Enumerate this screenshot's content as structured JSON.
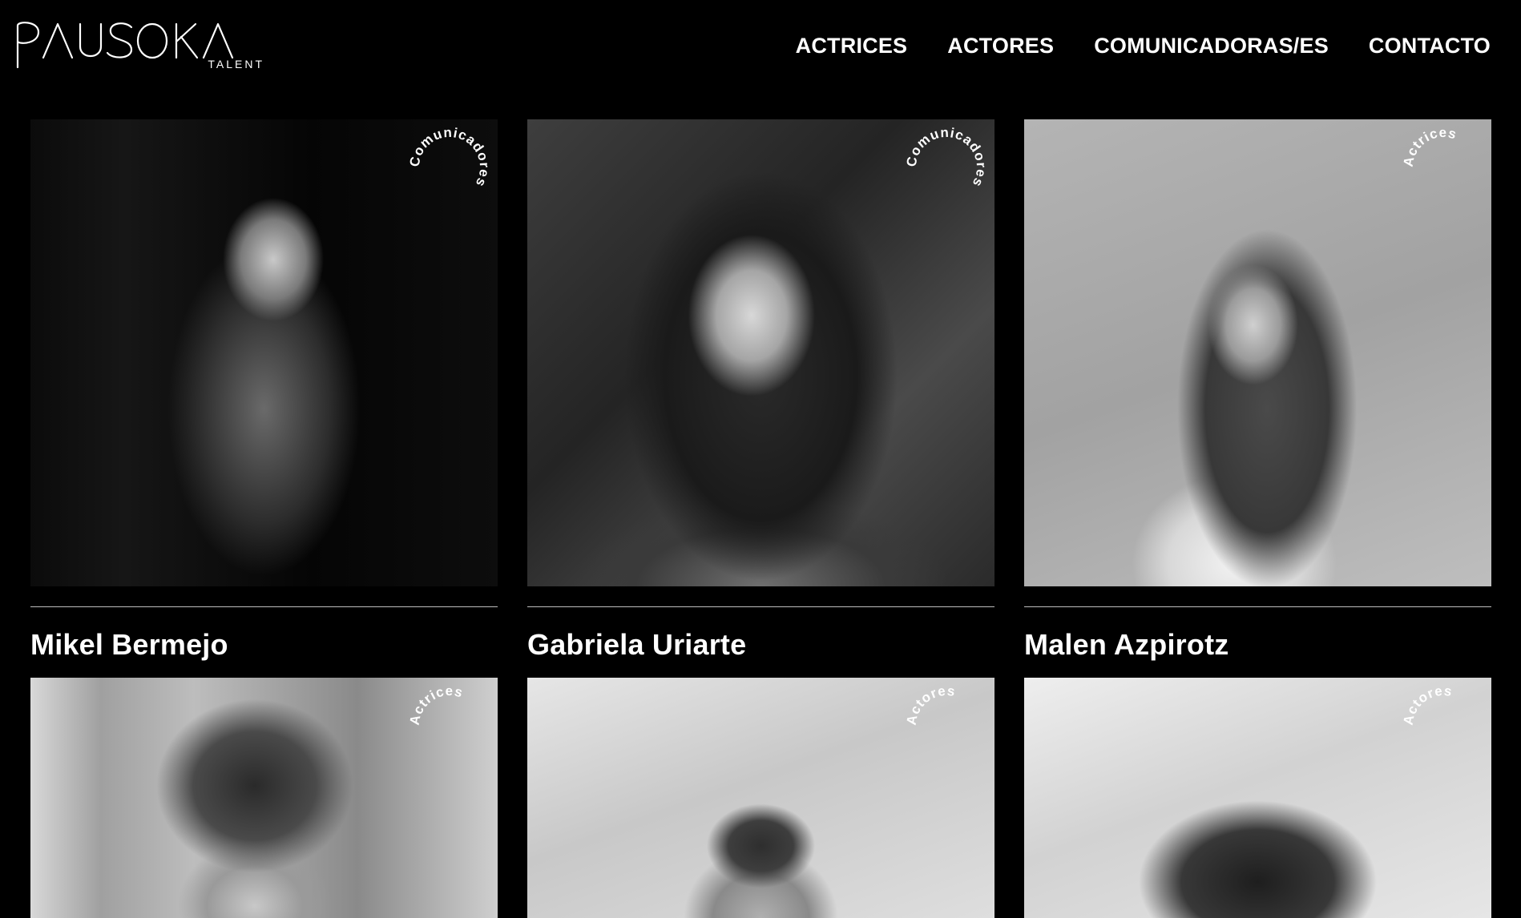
{
  "brand": {
    "logo_text": "PAUSOKA",
    "logo_sub": "TALENT"
  },
  "nav": [
    {
      "label": "ACTRICES"
    },
    {
      "label": "ACTORES"
    },
    {
      "label": "COMUNICADORAS/ES"
    },
    {
      "label": "CONTACTO"
    }
  ],
  "talents": [
    {
      "name": "Mikel Bermejo",
      "badge": "Comunicadores",
      "photo": "stage-comedian-photo"
    },
    {
      "name": "Gabriela Uriarte",
      "badge": "Comunicadores",
      "photo": "smiling-woman-portrait-photo"
    },
    {
      "name": "Malen Azpirotz",
      "badge": "Actrices",
      "photo": "woman-over-shoulder-portrait-photo"
    },
    {
      "name": "",
      "badge": "Actrices",
      "photo": "curly-hair-woman-portrait-photo"
    },
    {
      "name": "",
      "badge": "Actores",
      "photo": "short-hair-man-portrait-photo"
    },
    {
      "name": "",
      "badge": "Actores",
      "photo": "afro-hair-portrait-photo"
    }
  ],
  "colors": {
    "background": "#000000",
    "text": "#ffffff",
    "divider": "#bdbdbd"
  }
}
